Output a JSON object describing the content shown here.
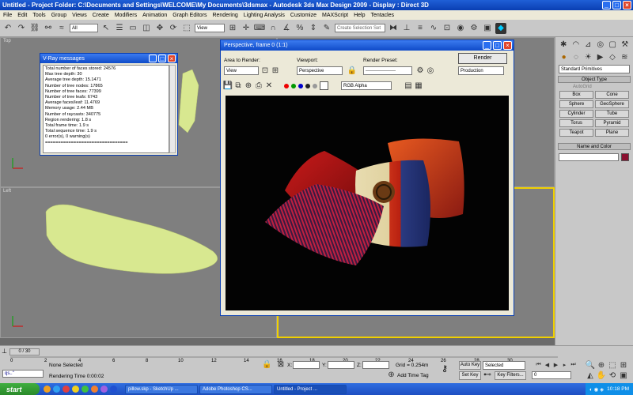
{
  "title": "Untitled   - Project Folder: C:\\Documents and Settings\\WELCOME\\My Documents\\3dsmax   - Autodesk 3ds Max Design 2009   - Display : Direct 3D",
  "menu": [
    "File",
    "Edit",
    "Tools",
    "Group",
    "Views",
    "Create",
    "Modifiers",
    "Animation",
    "Graph Editors",
    "Rendering",
    "Lighting Analysis",
    "Customize",
    "MAXScript",
    "Help",
    "Tentacles"
  ],
  "toolbar": {
    "selection_filter": "All",
    "view_combo": "View",
    "named_sel": "Create Selection Set"
  },
  "viewports": {
    "top": "Top",
    "left": "Left"
  },
  "vray": {
    "title": "V-Ray messages",
    "lines": [
      "Total number of faces stored: 24576",
      "Max tree depth: 30",
      "Average tree depth: 15.1471",
      "Number of tree nodes: 17865",
      "Number of tree faces: 77399",
      "Number of tree leafs: 6743",
      "Average faces/leaf: 11.4769",
      "Memory usage: 2.44 MB",
      "Number of raycasts: 340775",
      "Region rendering: 1.8 s",
      "Total frame time: 1.9 s",
      "Total sequence time: 1.9 s",
      "0 error(s), 0 warning(s)",
      "================================"
    ]
  },
  "render": {
    "title": "Perspective, frame 0 (1:1)",
    "area_label": "Area to Render:",
    "area_value": "View",
    "viewport_label": "Viewport:",
    "viewport_value": "Perspective",
    "preset_label": "Render Preset:",
    "preset_value": "-------------------",
    "render_button": "Render",
    "mode_value": "Production",
    "channel_value": "RGB Alpha"
  },
  "cmd": {
    "category": "Standard Primitives",
    "object_type": "Object Type",
    "autogrid": "AutoGrid",
    "objects": [
      "Box",
      "Cone",
      "Sphere",
      "GeoSphere",
      "Cylinder",
      "Tube",
      "Torus",
      "Pyramid",
      "Teapot",
      "Plane"
    ],
    "name_color": "Name and Color"
  },
  "timeline": {
    "frame": "0 / 30",
    "ticks": [
      "0",
      "2",
      "4",
      "6",
      "8",
      "10",
      "12",
      "14",
      "16",
      "18",
      "20",
      "22",
      "24",
      "26",
      "28",
      "30"
    ],
    "status": "None Selected",
    "render_time": "Rendering Time  0:00:02",
    "x_label": "X:",
    "y_label": "Y:",
    "z_label": "Z:",
    "grid": "Grid = 0.254m",
    "add_time_tag": "Add Time Tag",
    "auto_key": "Auto Key",
    "set_key": "Set Key",
    "selected": "Selected",
    "key_filters": "Key Filters...",
    "frame_field": "0",
    "script_field": "qs..\""
  },
  "taskbar": {
    "start": "start",
    "items": [
      "pillow.skp - SketchUp ...",
      "Adobe Photoshop CS...",
      "Untitled   - Project ..."
    ],
    "clock": "10:18 PM"
  },
  "colors": {
    "xp_blue": "#0a3fb3",
    "viewport_gray": "#7f7f7f",
    "active_viewport_border": "#f0d000",
    "mesh": "#d8e890"
  }
}
